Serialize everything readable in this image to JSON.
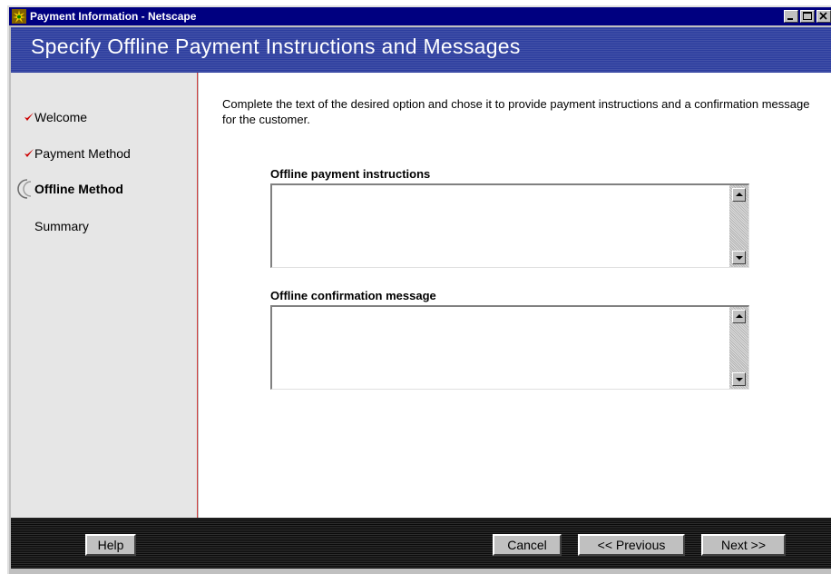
{
  "window": {
    "title": "Payment Information - Netscape",
    "icon": "netscape-app-icon",
    "controls": [
      "minimize",
      "maximize",
      "close"
    ]
  },
  "header": {
    "title": "Specify Offline Payment Instructions and Messages"
  },
  "sidebar": {
    "items": [
      {
        "label": "Welcome",
        "state": "completed",
        "icon": "check-icon"
      },
      {
        "label": "Payment Method",
        "state": "completed",
        "icon": "check-icon"
      },
      {
        "label": "Offline Method",
        "state": "current",
        "icon": "current-step-icon"
      },
      {
        "label": "Summary",
        "state": "pending",
        "icon": ""
      }
    ]
  },
  "main": {
    "intro": "Complete the text of the desired option and chose it to provide payment instructions and a confirmation message for the customer.",
    "fields": [
      {
        "label": "Offline payment instructions",
        "value": ""
      },
      {
        "label": "Offline confirmation message",
        "value": ""
      }
    ]
  },
  "footer": {
    "help_label": "Help",
    "cancel_label": "Cancel",
    "previous_label": "<< Previous",
    "next_label": "Next >>"
  },
  "colors": {
    "title_bar": "#000080",
    "banner": "#2c3d9e",
    "checkmark": "#cc0000",
    "sidebar_bg": "#e6e6e6",
    "footer_bg": "#111111",
    "button_face": "#c0c0c0"
  }
}
